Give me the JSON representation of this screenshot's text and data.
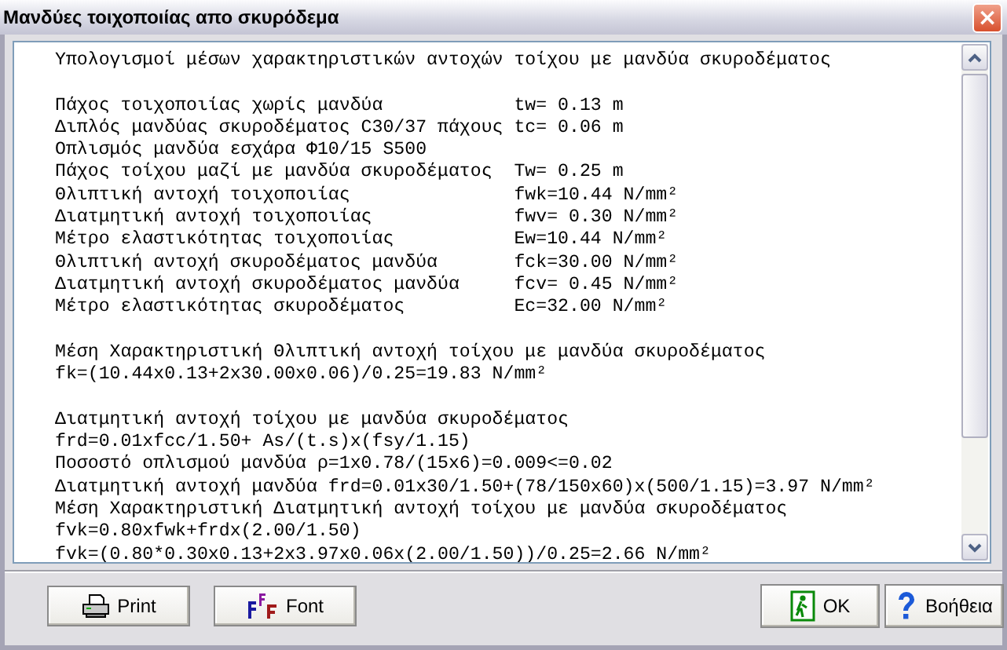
{
  "window": {
    "title": "Μανδύες τοιχοποιίας απο σκυρόδεμα",
    "close": "×"
  },
  "report": {
    "blocks": [
      [
        {
          "kind": "line",
          "text": "Υπολογισμοί μέσων χαρακτηριστικών αντοχών τοίχου με μανδύα σκυροδέματος"
        }
      ],
      [
        {
          "kind": "pair",
          "label": "Πάχος τοιχοποιίας χωρίς μανδύα",
          "value": "tw= 0.13 m"
        },
        {
          "kind": "pair",
          "label": "Διπλός μανδύας σκυροδέματος C30/37 πάχους",
          "value": "tc= 0.06 m"
        },
        {
          "kind": "line",
          "text": "Οπλισμός μανδύα εσχάρα Φ10/15 S500"
        },
        {
          "kind": "pair",
          "label": "Πάχος τοίχου μαζί με μανδύα σκυροδέματος",
          "value": "Tw= 0.25 m"
        },
        {
          "kind": "pair",
          "label": "Θλιπτική αντοχή τοιχοποιίας",
          "value": "fwk=10.44 N/mm²"
        },
        {
          "kind": "pair",
          "label": "Διατμητική αντοχή τοιχοποιίας",
          "value": "fwv= 0.30 N/mm²"
        },
        {
          "kind": "pair",
          "label": "Μέτρο ελαστικότητας τοιχοποιίας",
          "value": "Ew=10.44 N/mm²"
        },
        {
          "kind": "pair",
          "label": "Θλιπτική αντοχή σκυροδέματος μανδύα",
          "value": "fck=30.00 N/mm²"
        },
        {
          "kind": "pair",
          "label": "Διατμητική αντοχή σκυροδέματος μανδύα",
          "value": "fcv= 0.45 N/mm²"
        },
        {
          "kind": "pair",
          "label": "Μέτρο ελαστικότητας σκυροδέματος",
          "value": "Ec=32.00 N/mm²"
        }
      ],
      [
        {
          "kind": "line",
          "text": "Μέση Χαρακτηριστική Θλιπτική αντοχή τοίχου με μανδύα σκυροδέματος"
        },
        {
          "kind": "line",
          "text": "fk=(10.44x0.13+2x30.00x0.06)/0.25=19.83 N/mm²"
        }
      ],
      [
        {
          "kind": "line",
          "text": "Διατμητική αντοχή τοίχου με μανδύα σκυροδέματος"
        },
        {
          "kind": "line",
          "text": "frd=0.01xfcc/1.50+ As/(t.s)x(fsy/1.15)"
        },
        {
          "kind": "line",
          "text": "Ποσοστό οπλισμού μανδύα ρ=1x0.78/(15x6)=0.009<=0.02"
        },
        {
          "kind": "line",
          "text": "Διατμητική αντοχή μανδύα frd=0.01x30/1.50+(78/150x60)x(500/1.15)=3.97 N/mm²"
        },
        {
          "kind": "line",
          "text": "Μέση Χαρακτηριστική Διατμητική αντοχή τοίχου με μανδύα σκυροδέματος"
        },
        {
          "kind": "line",
          "text": "fvk=0.80xfwk+frdx(2.00/1.50)"
        },
        {
          "kind": "line",
          "text": "fvk=(0.80*0.30x0.13+2x3.97x0.06x(2.00/1.50))/0.25=2.66 N/mm²"
        }
      ]
    ]
  },
  "left_buttons": [
    {
      "kind": "print",
      "label": "Print"
    },
    {
      "kind": "font",
      "label": "Font"
    }
  ],
  "right_buttons": [
    {
      "kind": "exit",
      "label": "OK"
    },
    {
      "kind": "help",
      "label": "Βοήθεια"
    }
  ]
}
